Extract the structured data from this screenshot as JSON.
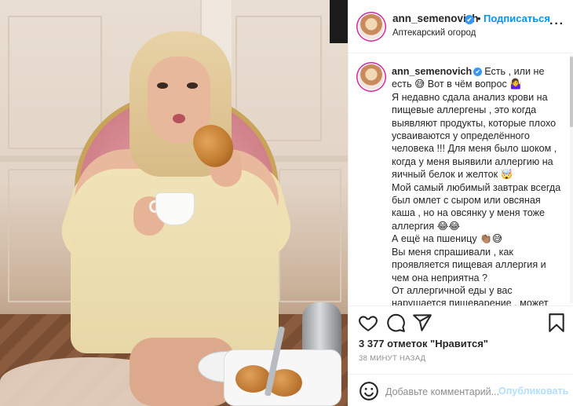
{
  "post": {
    "username": "ann_semenovich",
    "follow_label": "Подписаться",
    "separator": "•",
    "location": "Аптекарский огород",
    "more_label": "···",
    "verified_mark": "✔"
  },
  "caption": {
    "username": "ann_semenovich",
    "text": "Есть , или не есть 😅 Вот в чём вопрос 🤷‍♀️\nЯ недавно сдала анализ крови на пищевые аллергены , это когда выявляют продукты, которые плохо усваиваются у определённого человека !!! Для меня было шоком , когда у меня выявили аллергию на яичный белок и желток 🤯\nМой самый любимый завтрак всегда был омлет с сыром или овсяная каша , но на овсянку у меня тоже аллергия 😂😂\nА ещё на пшеницу 👏🏽😅\nВы меня спрашивали , как проявляется пищевая аллергия и чем она неприятна ?\nОт аллергичной еды у вас нарушается пищеварение , может быть вздутие живота или даже"
  },
  "actions": {
    "like_icon": "heart-icon",
    "comment_icon": "comment-icon",
    "share_icon": "share-icon",
    "save_icon": "bookmark-icon",
    "likes_text": "3 377 отметок \"Нравится\"",
    "time_text": "38 МИНУТ НАЗАД"
  },
  "comment": {
    "emoji_icon": "smiley-icon",
    "placeholder": "Добавьте комментарий...",
    "publish_label": "Опубликовать"
  },
  "colors": {
    "accent": "#0095f6",
    "publish_disabled": "#b2dffc",
    "verified": "#3897f0"
  }
}
